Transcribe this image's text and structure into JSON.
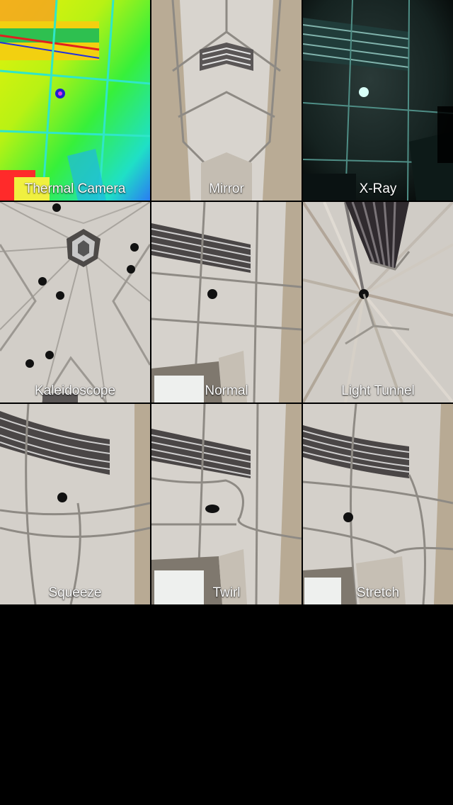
{
  "effects": [
    {
      "label": "Thermal Camera",
      "icon": "thermal-preview"
    },
    {
      "label": "Mirror",
      "icon": "mirror-preview"
    },
    {
      "label": "X-Ray",
      "icon": "xray-preview"
    },
    {
      "label": "Kaleidoscope",
      "icon": "kaleidoscope-preview"
    },
    {
      "label": "Normal",
      "icon": "normal-preview"
    },
    {
      "label": "Light Tunnel",
      "icon": "light-tunnel-preview"
    },
    {
      "label": "Squeeze",
      "icon": "squeeze-preview"
    },
    {
      "label": "Twirl",
      "icon": "twirl-preview"
    },
    {
      "label": "Stretch",
      "icon": "stretch-preview"
    }
  ],
  "colors": {
    "background": "#000000",
    "label": "#ffffff",
    "ceiling": "#d9d4cd",
    "wall": "#b8aa94"
  }
}
